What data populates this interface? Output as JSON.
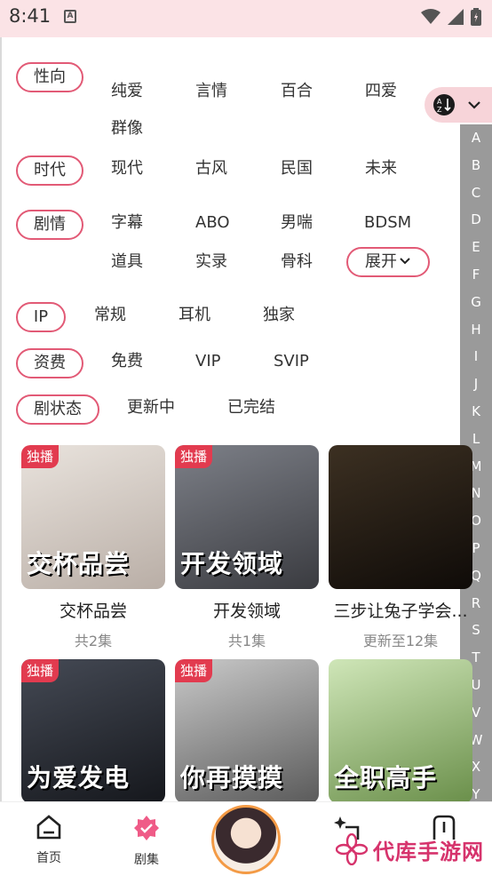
{
  "status_bar": {
    "time": "8:41"
  },
  "filters": [
    {
      "label": "性向",
      "options": [
        "纯爱",
        "言情",
        "百合",
        "四爱",
        "群像"
      ]
    },
    {
      "label": "时代",
      "options": [
        "现代",
        "古风",
        "民国",
        "未来"
      ]
    },
    {
      "label": "剧情",
      "options": [
        "字幕",
        "ABO",
        "男喘",
        "BDSM",
        "道具",
        "实录",
        "骨科"
      ],
      "expand_label": "展开"
    },
    {
      "label": "IP",
      "options": [
        "常规",
        "耳机",
        "独家"
      ]
    },
    {
      "label": "资费",
      "options": [
        "免费",
        "VIP",
        "SVIP"
      ]
    },
    {
      "label": "剧状态",
      "options": [
        "更新中",
        "已完结"
      ]
    }
  ],
  "alphabet": [
    "A",
    "B",
    "C",
    "D",
    "E",
    "F",
    "G",
    "H",
    "I",
    "J",
    "K",
    "L",
    "M",
    "N",
    "O",
    "P",
    "Q",
    "R",
    "S",
    "T",
    "U",
    "V",
    "W",
    "X",
    "Y"
  ],
  "cards": [
    {
      "tag": "独播",
      "cover_title": "交杯品尝",
      "name": "交杯品尝",
      "meta": "共2集",
      "colors": [
        "#e9e3dd",
        "#b9aea6"
      ]
    },
    {
      "tag": "独播",
      "cover_title": "开发领域",
      "name": "开发领域",
      "meta": "共1集",
      "colors": [
        "#7d8088",
        "#3a3b40"
      ]
    },
    {
      "tag": "",
      "cover_title": "",
      "name": "三步让兔子学会...",
      "meta": "更新至12集",
      "colors": [
        "#3c3022",
        "#0f0b08"
      ]
    },
    {
      "tag": "独播",
      "cover_title": "为爱发电",
      "name": "",
      "meta": "",
      "colors": [
        "#454a55",
        "#15171c"
      ]
    },
    {
      "tag": "独播",
      "cover_title": "你再摸摸",
      "name": "",
      "meta": "",
      "colors": [
        "#c9c9c9",
        "#5a5a5a"
      ]
    },
    {
      "tag": "",
      "cover_title": "全职高手",
      "name": "",
      "meta": "",
      "colors": [
        "#cfe6b8",
        "#6a8f4a"
      ]
    }
  ],
  "bottom_nav": [
    {
      "label": "首页",
      "icon": "home-icon"
    },
    {
      "label": "剧集",
      "icon": "episodes-icon"
    },
    {
      "label": "",
      "icon": "sparkle-icon"
    },
    {
      "label": "",
      "icon": "mine-icon"
    }
  ],
  "watermark": "代库手游网",
  "colors": {
    "accent": "#e25a76",
    "tag_red": "#e23b4f",
    "status_bg": "#fbe3e6"
  }
}
